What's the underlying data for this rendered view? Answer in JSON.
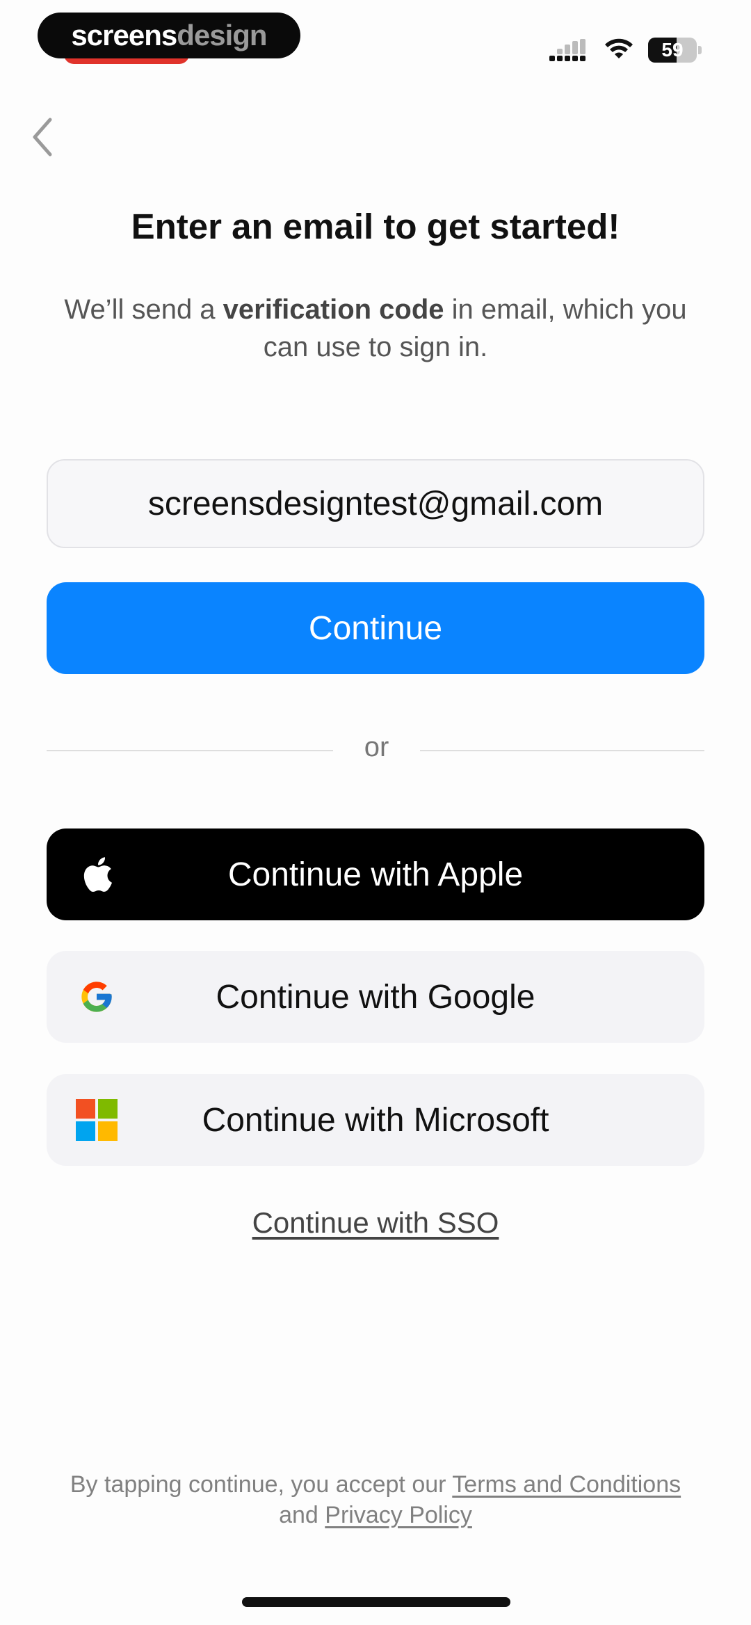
{
  "status_bar": {
    "brand_part1": "screens",
    "brand_part2": "design",
    "battery_level": "59",
    "battery_fraction": 0.59
  },
  "header": {
    "title": "Enter an email to get started!",
    "subtitle_pre": "We’ll send a ",
    "subtitle_bold": "verification code",
    "subtitle_post": " in email, which you can use to sign in."
  },
  "form": {
    "email_value": "screensdesigntest@gmail.com",
    "continue_label": "Continue"
  },
  "divider": {
    "or_label": "or"
  },
  "providers": {
    "apple_label": "Continue with Apple",
    "google_label": "Continue with Google",
    "microsoft_label": "Continue with Microsoft",
    "sso_label": "Continue with SSO"
  },
  "legal": {
    "prefix": "By tapping continue, you accept our ",
    "terms_label": "Terms and Conditions",
    "middle": " and ",
    "privacy_label": "Privacy Policy"
  },
  "colors": {
    "primary": "#0a84ff",
    "apple_bg": "#000000",
    "secondary_bg": "#f3f3f6",
    "ms_red": "#f25022",
    "ms_green": "#7fba00",
    "ms_blue": "#00a4ef",
    "ms_yellow": "#ffb900"
  },
  "icons": {
    "back": "chevron-left-icon",
    "apple": "apple-logo-icon",
    "google": "google-logo-icon",
    "microsoft": "microsoft-logo-icon",
    "signal": "cellular-signal-icon",
    "wifi": "wifi-icon",
    "battery": "battery-icon"
  }
}
